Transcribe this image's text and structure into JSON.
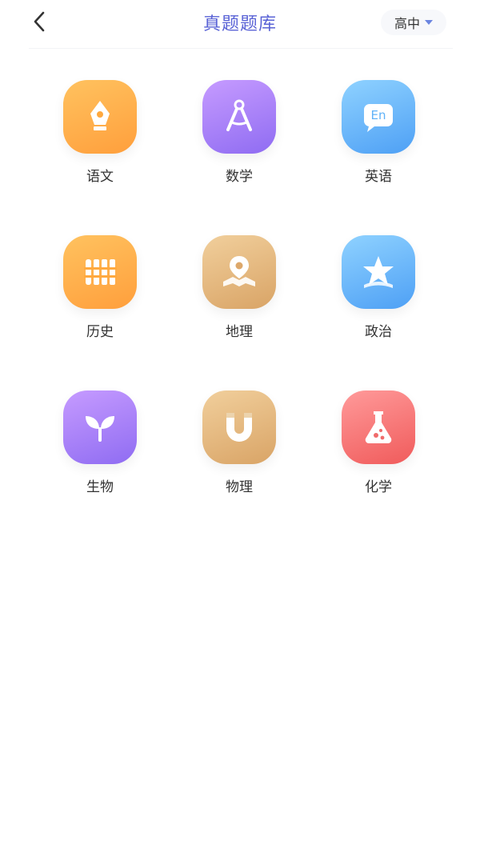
{
  "header": {
    "title": "真题题库",
    "level": "高中"
  },
  "subjects": [
    {
      "label": "语文",
      "icon": "fountain-pen-icon",
      "color": "#ffa93f"
    },
    {
      "label": "数学",
      "icon": "compass-icon",
      "color": "#9d78f5"
    },
    {
      "label": "英语",
      "icon": "english-speech-icon",
      "color": "#5fb2f8"
    },
    {
      "label": "历史",
      "icon": "scroll-books-icon",
      "color": "#ffa93f"
    },
    {
      "label": "地理",
      "icon": "map-pin-icon",
      "color": "#dda86b"
    },
    {
      "label": "政治",
      "icon": "star-icon",
      "color": "#5fb2f8"
    },
    {
      "label": "生物",
      "icon": "sprout-icon",
      "color": "#9d78f5"
    },
    {
      "label": "物理",
      "icon": "magnet-icon",
      "color": "#dda86b"
    },
    {
      "label": "化学",
      "icon": "flask-icon",
      "color": "#f06b6b"
    }
  ],
  "icon_text": {
    "english": "En"
  }
}
